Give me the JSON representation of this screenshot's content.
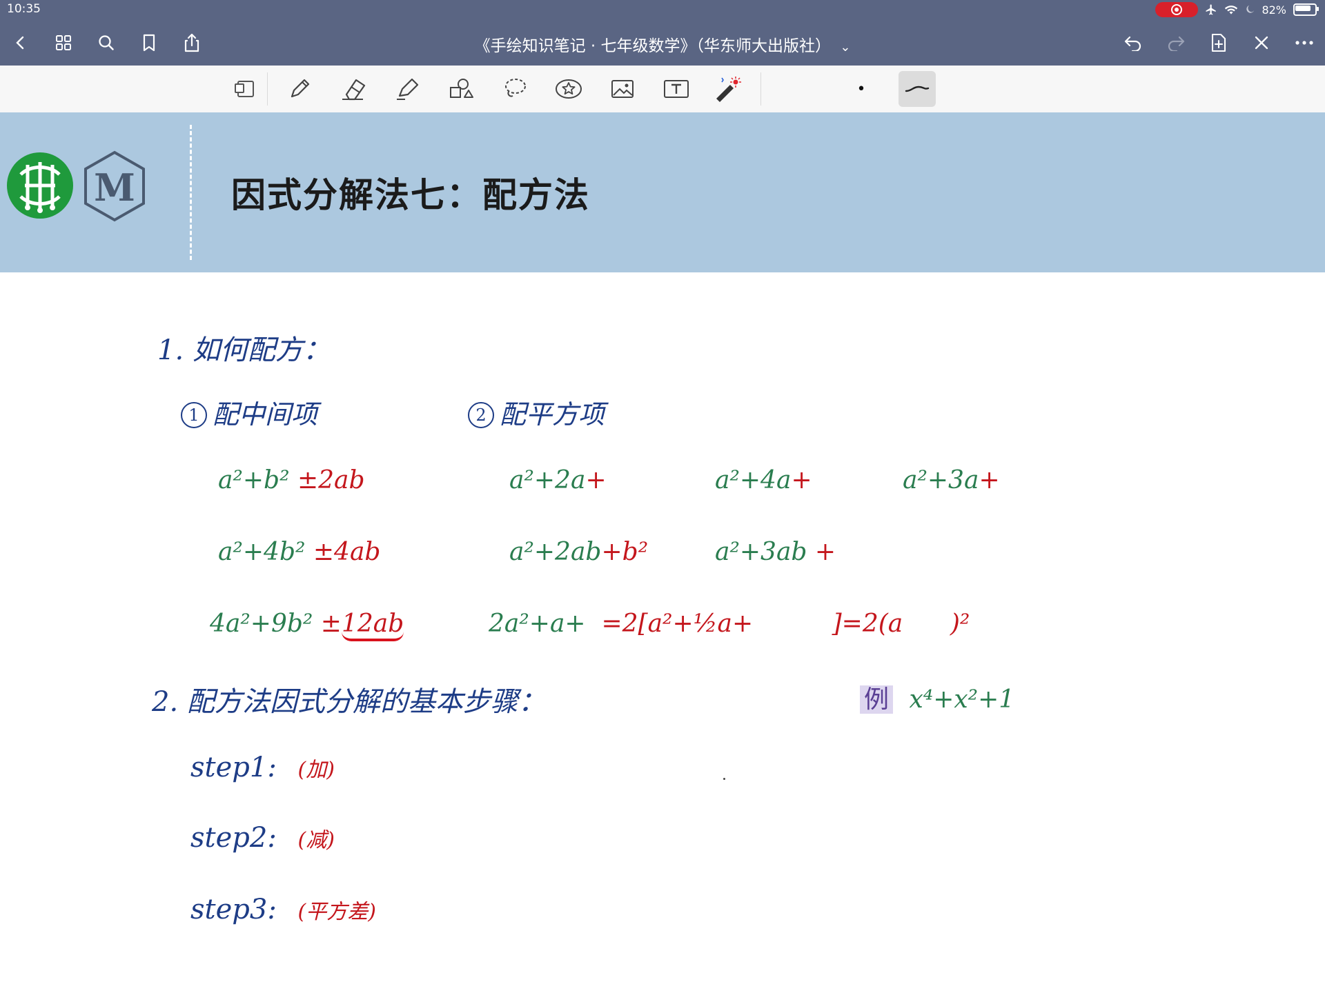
{
  "status": {
    "time": "10:35",
    "battery": "82%"
  },
  "nav": {
    "title": "《手绘知识笔记 · 七年级数学》（华东师大出版社）",
    "title_caret": "⌄"
  },
  "toolbar": {
    "tools": [
      "page-layout",
      "pen",
      "eraser",
      "highlighter",
      "shapes",
      "lasso",
      "sticker",
      "image",
      "text",
      "laser-pointer"
    ],
    "pen_size_dot": "•"
  },
  "banner": {
    "title": "因式分解法七：配方法",
    "logo_text": "M"
  },
  "notes": {
    "section1": "1. 如何配方：",
    "sub1_num": "1",
    "sub1_label": "配中间项",
    "sub2_num": "2",
    "sub2_label": "配平方项",
    "left_col": [
      {
        "green": "a²+b²",
        "red": " ±2ab"
      },
      {
        "green": "a²+4b²",
        "red": " ±4ab"
      },
      {
        "green": "4a²+9b²",
        "red_pm": " ±",
        "red": "12ab"
      }
    ],
    "mid_col": [
      {
        "green": "a²+2a",
        "red": "+"
      },
      {
        "green": "a²+2ab",
        "red": "+b²"
      },
      {
        "green": "2a²+a+",
        "red": "  =2[a²+½a+          ]=2(a      )²"
      }
    ],
    "right_col_r1": [
      {
        "green": "a²+4a",
        "red": "+"
      },
      {
        "green": "a²+3a",
        "red": "+"
      }
    ],
    "right_col_r2": {
      "green": "a²+3ab",
      "red": " +"
    },
    "section2": "2. 配方法因式分解的基本步骤：",
    "example_tag": "例",
    "example_expr": "x⁴+x²+1",
    "steps": [
      {
        "label": "step1:",
        "note": "(加)"
      },
      {
        "label": "step2:",
        "note": "(减)"
      },
      {
        "label": "step3:",
        "note": "(平方差)"
      }
    ]
  }
}
